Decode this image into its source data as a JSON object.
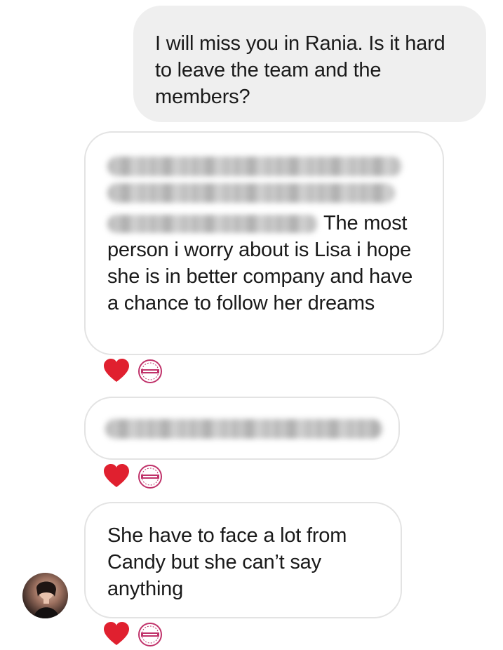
{
  "messages": [
    {
      "direction": "sent",
      "text": "I will miss you in Rania. Is it hard to leave the team and the members?"
    },
    {
      "direction": "received",
      "blurred_lines": 3,
      "text": "The most person i worry about is Lisa i hope she is in better company and have a chance to follow her dreams",
      "reactions": [
        "heart",
        "sticker"
      ]
    },
    {
      "direction": "received",
      "blurred_lines": 1,
      "text": "",
      "reactions": [
        "heart",
        "sticker"
      ]
    },
    {
      "direction": "received",
      "text": "She have to face a lot from Candy but she can’t say anything",
      "reactions": [
        "heart",
        "sticker"
      ],
      "has_avatar": true
    }
  ],
  "colors": {
    "sent_bubble": "#efefef",
    "received_border": "#e3e3e3",
    "heart": "#e0202f",
    "sticker": "#c0326a"
  },
  "icons": {
    "heart": "heart-reaction-icon",
    "sticker": "rania-sticker-icon"
  }
}
